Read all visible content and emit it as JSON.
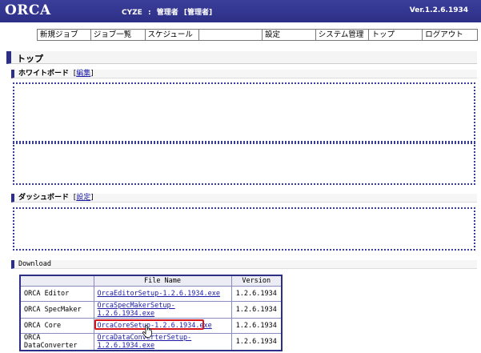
{
  "header": {
    "logo": "ORCA",
    "user_id": "CYZE",
    "separator": ":",
    "user_name": "管理者",
    "user_role": "[管理者]",
    "version": "Ver.1.2.6.1934"
  },
  "menu": [
    {
      "label": "新規ジョブ"
    },
    {
      "label": "ジョブ一覧"
    },
    {
      "label": "スケジュール"
    },
    {
      "label": ""
    },
    {
      "label": "設定"
    },
    {
      "label": "システム管理"
    },
    {
      "label": "トップ"
    },
    {
      "label": "ログアウト"
    }
  ],
  "page_title": "トップ",
  "whiteboard": {
    "title": "ホワイトボード",
    "edit_open": "[",
    "edit_link": "編集",
    "edit_close": "]"
  },
  "dashboard": {
    "title": "ダッシュボード",
    "edit_open": "[",
    "edit_link": "設定",
    "edit_close": "]"
  },
  "download": {
    "title": "Download",
    "columns": [
      "",
      "File Name",
      "Version"
    ],
    "rows": [
      {
        "name": "ORCA Editor",
        "file": "OrcaEditorSetup-1.2.6.1934.exe",
        "version": "1.2.6.1934"
      },
      {
        "name": "ORCA SpecMaker",
        "file": "OrcaSpecMakerSetup-1.2.6.1934.exe",
        "version": "1.2.6.1934"
      },
      {
        "name": "ORCA Core",
        "file": "OrcaCoreSetup-1.2.6.1934.exe",
        "version": "1.2.6.1934"
      },
      {
        "name": "ORCA DataConverter",
        "file": "OrcaDataConverterSetup-1.2.6.1934.exe",
        "version": "1.2.6.1934"
      }
    ]
  },
  "colors": {
    "header_bg": "#2d2f86",
    "link": "#1a1aa6",
    "highlight": "#d6141a"
  },
  "icons": {
    "cursor": "hand-pointer-icon"
  }
}
